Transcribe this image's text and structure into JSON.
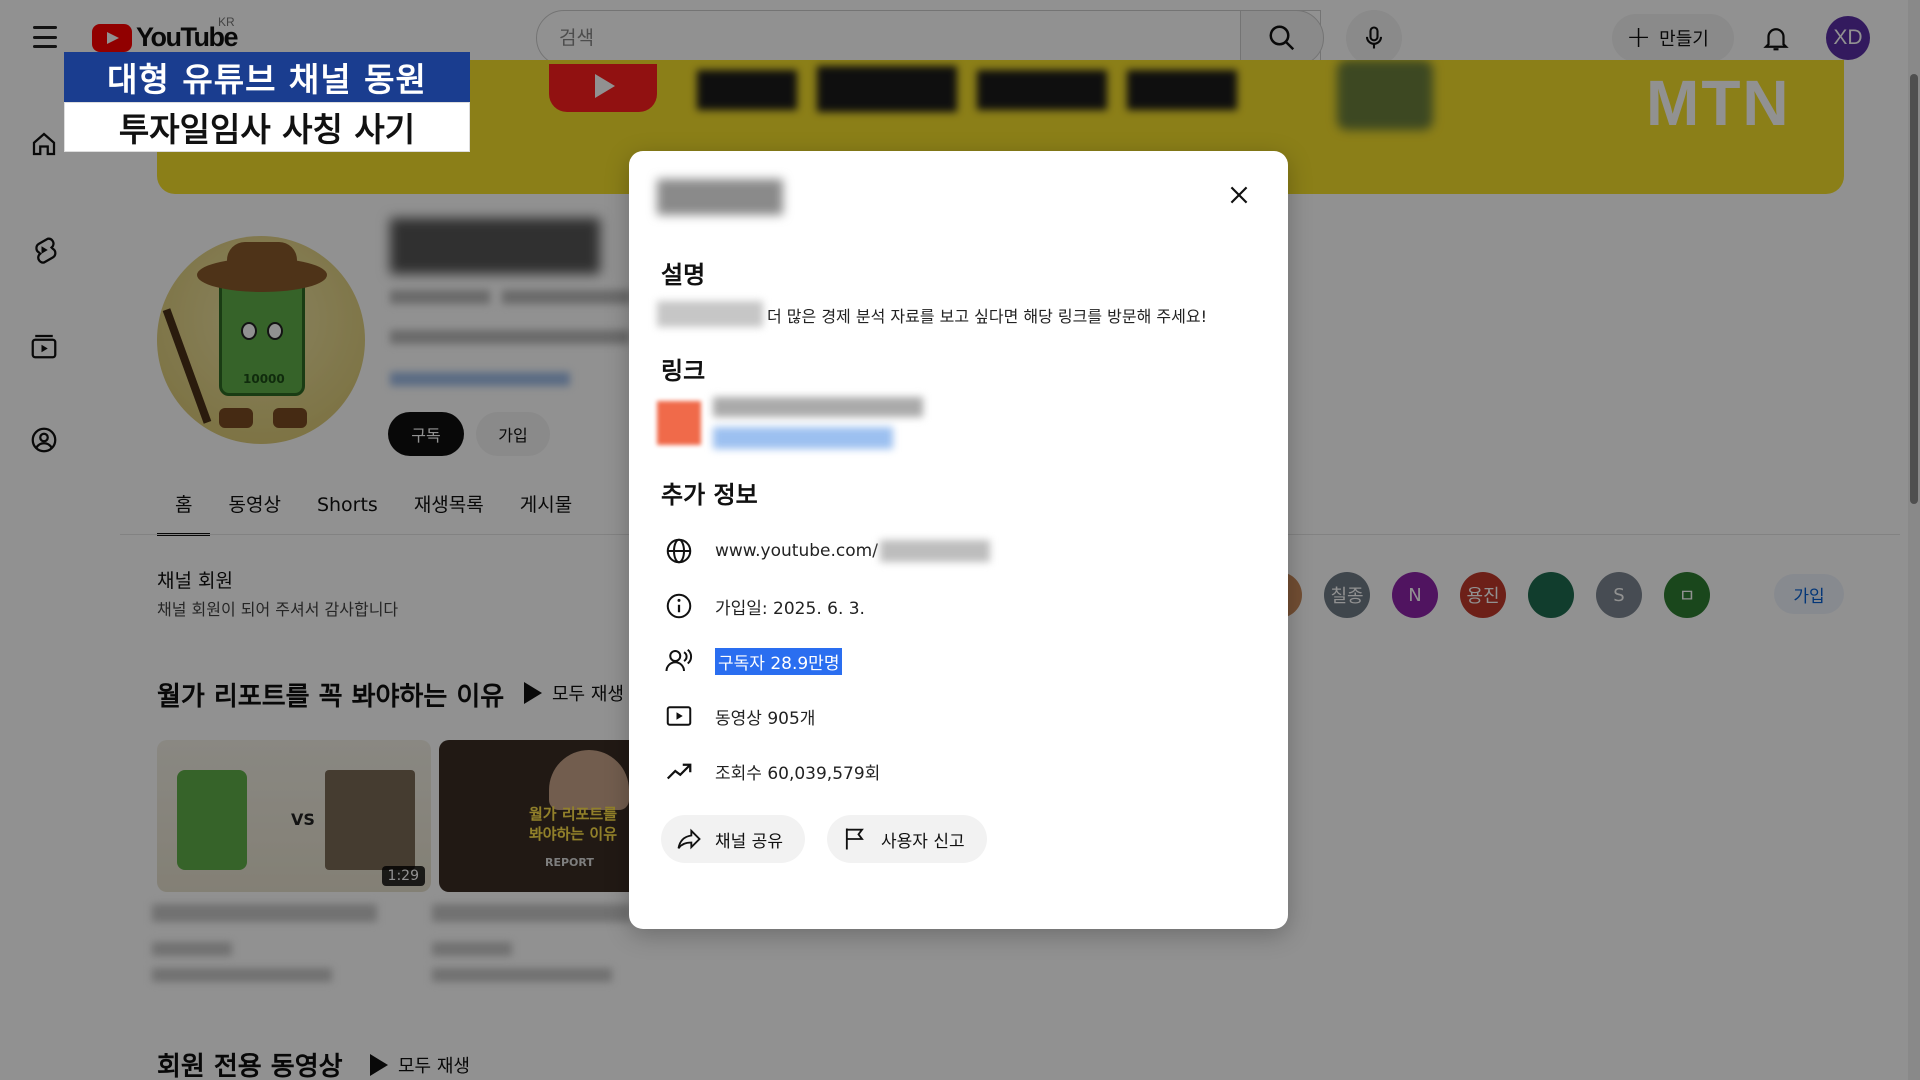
{
  "header": {
    "logo_text": "YouTube",
    "country_code": "KR",
    "search_placeholder": "검색",
    "create_label": "만들기",
    "avatar_initials": "XD"
  },
  "news": {
    "chyron_line1": "대형 유튜브 채널 동원",
    "chyron_line2": "투자일임사 사칭 사기",
    "broadcaster": "MTN"
  },
  "channel": {
    "mascot_value": "10000",
    "subscribe_label": "구독",
    "join_label": "가입",
    "tabs": [
      "홈",
      "동영상",
      "Shorts",
      "재생목록",
      "게시물"
    ],
    "members_title": "채널 회원",
    "members_subtitle": "채널 회원이 되어 주셔서 감사합니다",
    "members": [
      {
        "label": "",
        "color": "#c98a5a"
      },
      {
        "label": "칠종",
        "color": "#6f7b86"
      },
      {
        "label": "N",
        "color": "#8e24aa"
      },
      {
        "label": "용진",
        "color": "#c0392b"
      },
      {
        "label": "",
        "color": "#1e6b4f"
      },
      {
        "label": "S",
        "color": "#7d8792"
      },
      {
        "label": "ㅁ",
        "color": "#2e7d32"
      }
    ],
    "members_join_label": "가입",
    "section1_title": "월가 리포트를 꼭 봐야하는 이유",
    "play_all_label": "모두 재생",
    "thumb1_vs": "VS",
    "thumb1_duration": "1:29",
    "thumb2_text_line1": "월가 리포트를",
    "thumb2_text_line2": "봐야하는 이유",
    "thumb2_report": "REPORT",
    "section2_title": "회원 전용 동영상"
  },
  "dialog": {
    "description_heading": "설명",
    "description_text": "더 많은 경제 분석 자료를 보고 싶다면 해당 링크를 방문해 주세요!",
    "links_heading": "링크",
    "extra_heading": "추가 정보",
    "url_text": "www.youtube.com/",
    "joined_text": "가입일: 2025. 6. 3.",
    "subscribers_text": "구독자 28.9만명",
    "videos_text": "동영상 905개",
    "views_text": "조회수 60,039,579회",
    "share_label": "채널 공유",
    "report_label": "사용자 신고"
  }
}
